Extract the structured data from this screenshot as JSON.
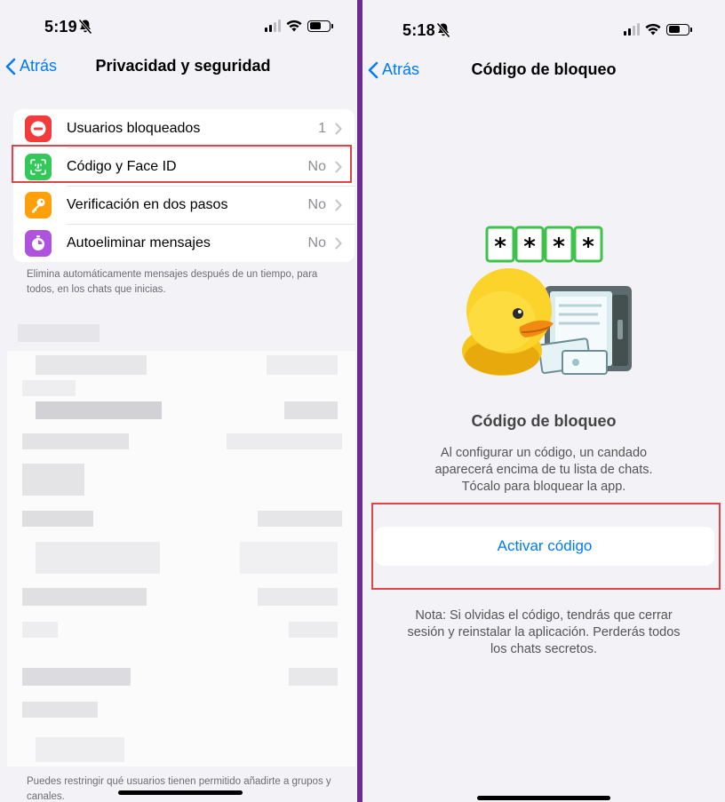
{
  "left": {
    "status": {
      "time": "5:19"
    },
    "nav": {
      "back_label": "Atrás",
      "title": "Privacidad y seguridad"
    },
    "settings": [
      {
        "label": "Usuarios bloqueados",
        "value": "1",
        "icon": "blocked-icon",
        "color": "#f23c3c"
      },
      {
        "label": "Código y Face ID",
        "value": "No",
        "icon": "face-id-icon",
        "color": "#34c759"
      },
      {
        "label": "Verificación en dos pasos",
        "value": "No",
        "icon": "key-icon",
        "color": "#ff9f0a"
      },
      {
        "label": "Autoeliminar mensajes",
        "value": "No",
        "icon": "timer-icon",
        "color": "#af52de"
      }
    ],
    "footnote_autodelete": "Elimina automáticamente mensajes después de un tiempo, para todos, en los chats que inicias.",
    "footnote_groups": "Puedes restringir qué usuarios tienen permitido añadirte a grupos y canales."
  },
  "right": {
    "status": {
      "time": "5:18"
    },
    "nav": {
      "back_label": "Atrás",
      "title": "Código de bloqueo"
    },
    "passcode_chars": [
      "*",
      "*",
      "*",
      "*"
    ],
    "heading": "Código de bloqueo",
    "description": "Al configurar un código, un candado aparecerá encima de tu lista de chats. Tócalo para bloquear la app.",
    "button_label": "Activar código",
    "note": "Nota: Si olvidas el código, tendrás que cerrar sesión y reinstalar la aplicación. Perderás todos los chats secretos."
  },
  "colors": {
    "accent": "#007aff",
    "highlight": "#e0444a",
    "divider": "#6a2c91",
    "background": "#f2f2f7"
  }
}
